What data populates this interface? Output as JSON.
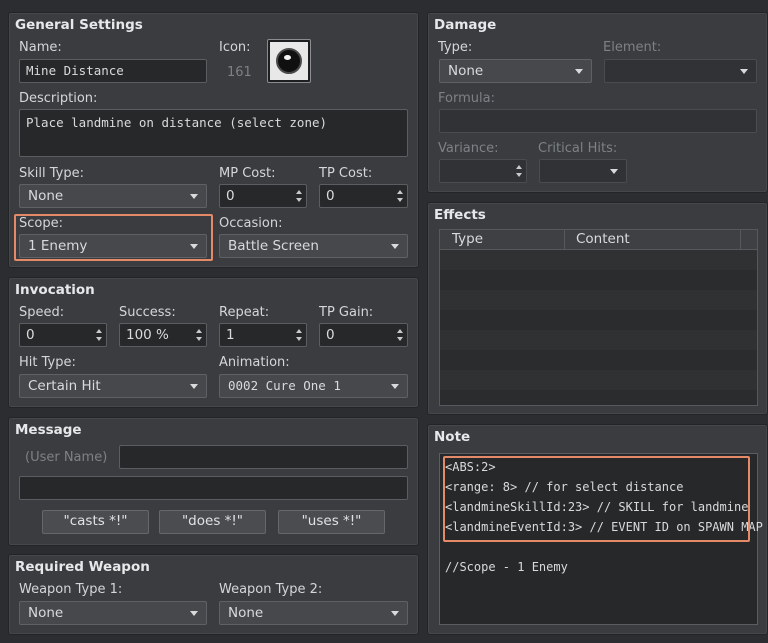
{
  "general": {
    "title": "General Settings",
    "name_label": "Name:",
    "name_value": "Mine Distance",
    "icon_label": "Icon:",
    "icon_index": "161",
    "description_label": "Description:",
    "description_value": "Place landmine on distance (select zone)",
    "skill_type_label": "Skill Type:",
    "skill_type_value": "None",
    "mp_cost_label": "MP Cost:",
    "mp_cost_value": "0",
    "tp_cost_label": "TP Cost:",
    "tp_cost_value": "0",
    "scope_label": "Scope:",
    "scope_value": "1 Enemy",
    "occasion_label": "Occasion:",
    "occasion_value": "Battle Screen"
  },
  "invocation": {
    "title": "Invocation",
    "speed_label": "Speed:",
    "speed_value": "0",
    "success_label": "Success:",
    "success_value": "100 %",
    "repeat_label": "Repeat:",
    "repeat_value": "1",
    "tp_gain_label": "TP Gain:",
    "tp_gain_value": "0",
    "hit_type_label": "Hit Type:",
    "hit_type_value": "Certain Hit",
    "animation_label": "Animation:",
    "animation_value": "0002 Cure One 1"
  },
  "message": {
    "title": "Message",
    "user_name_placeholder": "(User Name)",
    "buttons": [
      "\"casts *!\"",
      "\"does *!\"",
      "\"uses *!\""
    ]
  },
  "required_weapon": {
    "title": "Required Weapon",
    "type1_label": "Weapon Type 1:",
    "type1_value": "None",
    "type2_label": "Weapon Type 2:",
    "type2_value": "None"
  },
  "damage": {
    "title": "Damage",
    "type_label": "Type:",
    "type_value": "None",
    "element_label": "Element:",
    "element_value": "",
    "formula_label": "Formula:",
    "formula_value": "",
    "variance_label": "Variance:",
    "critical_label": "Critical Hits:"
  },
  "effects": {
    "title": "Effects",
    "columns": [
      "Type",
      "Content"
    ]
  },
  "note": {
    "title": "Note",
    "lines": [
      "<ABS:2>",
      "<range: 8> // for select distance",
      "<landmineSkillId:23> // SKILL for landmine",
      "<landmineEventId:3> // EVENT ID on SPAWN MAP",
      "",
      "//Scope - 1 Enemy"
    ]
  },
  "colors": {
    "highlight": "#e58a68",
    "panel": "#3a3c3f",
    "background": "#2b2d30"
  }
}
